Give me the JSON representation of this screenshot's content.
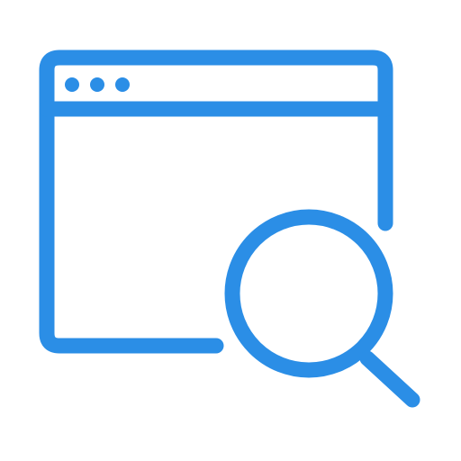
{
  "icon": {
    "name": "browser-window-search-icon",
    "parts": [
      "browser-window-icon",
      "window-dots-icon",
      "magnifying-glass-icon"
    ]
  },
  "colors": {
    "stroke": "#2b8ee6",
    "background": "#ffffff"
  }
}
